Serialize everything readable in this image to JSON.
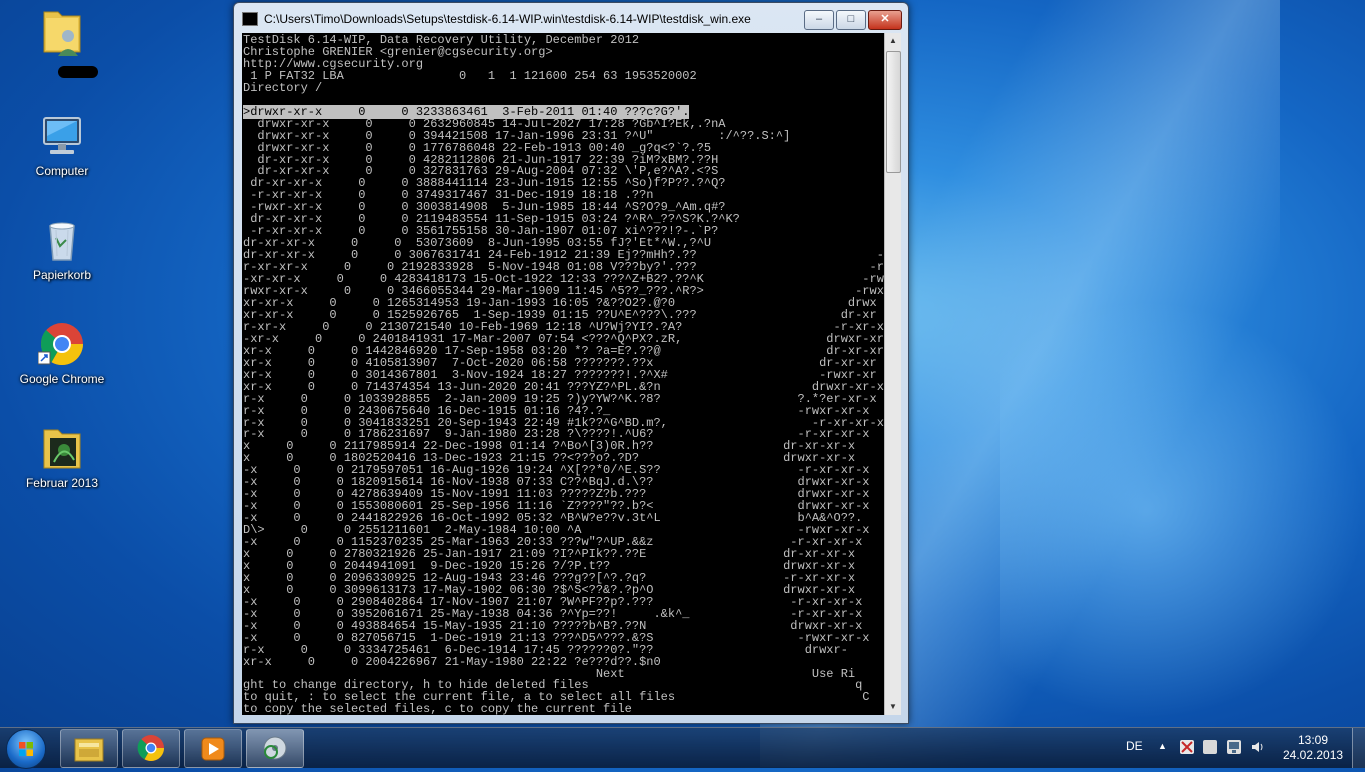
{
  "desktop": {
    "icons": [
      {
        "label": ""
      },
      {
        "label": "Computer"
      },
      {
        "label": "Papierkorb"
      },
      {
        "label": "Google Chrome"
      },
      {
        "label": "Februar 2013"
      }
    ]
  },
  "window": {
    "title": "C:\\Users\\Timo\\Downloads\\Setups\\testdisk-6.14-WIP.win\\testdisk-6.14-WIP\\testdisk_win.exe",
    "min_label": "–",
    "max_label": "□",
    "close_label": "✕",
    "scroll_up": "▲",
    "scroll_down": "▼"
  },
  "terminal": {
    "header": [
      "TestDisk 6.14-WIP, Data Recovery Utility, December 2012",
      "Christophe GRENIER <grenier@cgsecurity.org>",
      "http://www.cgsecurity.org",
      " 1 P FAT32 LBA                0   1  1 121600 254 63 1953520002",
      "Directory /",
      ""
    ],
    "selected": ">drwxr-xr-x     0     0 3233863461  3-Feb-2011 01:40 ???c?G?'.",
    "rows": [
      "  drwxr-xr-x     0     0 2632960845 14-Jul-2027 17:28 ?Gb^I?Ek,.?nA",
      "  drwxr-xr-x     0     0 394421508 17-Jan-1996 23:31 ?^U\"         :/^??.S:^]",
      "  drwxr-xr-x     0     0 1776786048 22-Feb-1913 00:40 _g?q<?`?.?5",
      "  dr-xr-xr-x     0     0 4282112806 21-Jun-1917 22:39 ?iM?xBM?.??H",
      "  dr-xr-xr-x     0     0 327831763 29-Aug-2004 07:32 \\'P,e?^A?.<?S",
      " dr-xr-xr-x     0     0 3888441114 23-Jun-1915 12:55 ^So)f?P??.?^Q?",
      " -r-xr-xr-x     0     0 3749317467 31-Dec-1919 18:18 .??n",
      " -rwxr-xr-x     0     0 3003814908  5-Jun-1985 18:44 ^S?O?9_^Am.q#?",
      " dr-xr-xr-x     0     0 2119483554 11-Sep-1915 03:24 ?^R^_??^S?K.?^K?",
      " -r-xr-xr-x     0     0 3561755158 30-Jan-1907 01:07 xi^???!?-.`P?",
      "dr-xr-xr-x     0     0  53073609  8-Jun-1995 03:55 fJ?'Et*^W.,?^U",
      "dr-xr-xr-x     0     0 3067631741 24-Feb-1912 21:39 Ej??mHh?.??                         -",
      "r-xr-xr-x     0     0 2192833928  5-Nov-1948 01:08 V???by?'.???                        -r",
      "-xr-xr-x     0     0 4283418173 15-Oct-1922 12:33 ???^Z+B2?.??^K                      -rw",
      "rwxr-xr-x     0     0 3466055344 29-Mar-1909 11:45 ^5??_???.^R?>                     -rwx",
      "xr-xr-x     0     0 1265314953 19-Jan-1993 16:05 ?&??O2?.@?0                        drwx",
      "xr-xr-x     0     0 1525926765  1-Sep-1939 01:15 ??U^E^???\\.???                    dr-xr",
      "r-xr-x     0     0 2130721540 10-Feb-1969 12:18 ^U?Wj?YI?.?A?                     -r-xr-x",
      "-xr-x     0     0 2401841931 17-Mar-2007 07:54 <???^Q^PX?.zR,                    drwxr-xr",
      "xr-x     0     0 1442846920 17-Sep-1958 03:20 *? ?a=E?.??@                       dr-xr-xr",
      "xr-x     0     0 4105813907  7-Oct-2020 06:58 ???????.??x                       dr-xr-xr",
      "xr-x     0     0 3014367801  3-Nov-1924 18:27 ???????!.?^X#                     -rwxr-xr",
      "xr-x     0     0 714374354 13-Jun-2020 20:41 ???YZ?^PL.&?n                     drwxr-xr-x",
      "r-x     0     0 1033928855  2-Jan-2009 19:25 ?)y?YW?^K.?8?                   ?.*?er-xr-x",
      "r-x     0     0 2430675640 16-Dec-1915 01:16 ?4?.?_                          -rwxr-xr-x",
      "r-x     0     0 3041833251 20-Sep-1943 22:49 #1k??^G^BD.m?,                    -r-xr-xr-x",
      "r-x     0     0 1786231697  9-Jan-1980 23:28 ?\\????!.^U6?                    -r-xr-xr-x",
      "x     0     0 2117985914 22-Dec-1998 01:14 ?^Bo^[3)0R.h??                  dr-xr-xr-x",
      "x     0     0 1802520416 13-Dec-1923 21:15 ??<???o?.?D?                    drwxr-xr-x",
      "-x     0     0 2179597051 16-Aug-1926 19:24 ^X[??*0/^E.S??                   -r-xr-xr-x",
      "-x     0     0 1820915614 16-Nov-1938 07:33 C??^BqJ.d.\\??                    drwxr-xr-x",
      "-x     0     0 4278639409 15-Nov-1991 11:03 ?????Z?b.???                     drwxr-xr-x",
      "-x     0     0 1553080601 25-Sep-1956 11:16 `Z????\"??.b?<                    drwxr-xr-x",
      "-x     0     0 2441822926 16-Oct-1992 05:32 ^B^W?e??v.3t^L                   b^A&^O??.",
      "D\\>     0     0 2551211601  2-May-1984 10:00 ^A                              -rwxr-xr-x",
      "-x     0     0 1152370235 25-Mar-1963 20:33 ???w\"?^UP.&&z                   -r-xr-xr-x",
      "x     0     0 2780321926 25-Jan-1917 21:09 ?I?^PIk??.??E                   dr-xr-xr-x",
      "x     0     0 2044941091  9-Dec-1920 15:26 ?/?P.t??                        drwxr-xr-x",
      "x     0     0 2096330925 12-Aug-1943 23:46 ???g??[^?.?q?                   -r-xr-xr-x",
      "x     0     0 3099613173 17-May-1902 06:30 ?$^S<??&?.?p^O                  drwxr-xr-x",
      "-x     0     0 2908402864 17-Nov-1907 21:07 ?W^PF??p?.???                   -r-xr-xr-x",
      "-x     0     0 3952061671 25-May-1938 04:36 ?^Yp=??!     .&k^_              -r-xr-xr-x",
      "-x     0     0 493884654 15-May-1935 21:10 ?????b^B?.??N                    drwxr-xr-x",
      "-x     0     0 827056715  1-Dec-1919 21:13 ???^D5^???.&?S                    -rwxr-xr-x",
      "r-x     0     0 3334725461  6-Dec-1914 17:45 ??????0?.\"??                     drwxr-",
      "xr-x     0     0 2004226967 21-May-1980 22:22 ?e???d??.$n0"
    ],
    "footer": [
      "                                                 Next                          Use Ri",
      "ght to change directory, h to hide deleted files                                     q",
      "to quit, : to select the current file, a to select all files                          C",
      "to copy the selected files, c to copy the current file"
    ]
  },
  "taskbar": {
    "language": "DE",
    "tray_arrow": "▲",
    "time": "13:09",
    "date": "24.02.2013"
  },
  "colors": {
    "console_bg": "#000000",
    "console_fg": "#c0c0c0",
    "desktop_blue": "#1466c4"
  }
}
